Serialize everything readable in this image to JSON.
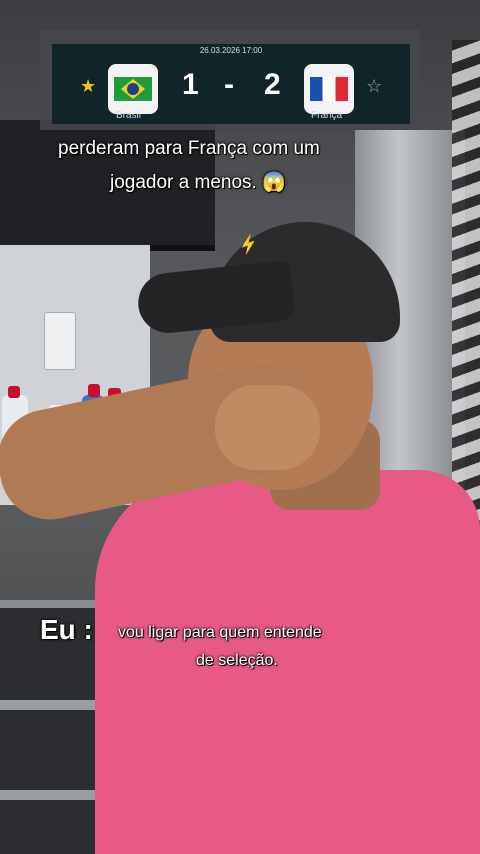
{
  "scoreboard": {
    "datetime": "26.03.2026 17:00",
    "home_team": "Brasil",
    "away_team": "França",
    "home_score": "1",
    "separator": "-",
    "away_score": "2",
    "home_star": "★",
    "away_star": "☆",
    "home_flag_icon": "brazil-flag-icon",
    "away_flag_icon": "france-flag-icon"
  },
  "top_caption": {
    "line1": "perderam para França com um",
    "line2": "jogador a menos. 😱"
  },
  "bottom_caption": {
    "speaker": "Eu :",
    "line1": "vou ligar para quem entende",
    "line2": "de seleção."
  },
  "colors": {
    "scoreboard_bg": "#102429",
    "shirt": "#e85a86",
    "brazil_green": "#1f9a3c",
    "brazil_yellow": "#f5d118",
    "france_blue": "#1a4fb0",
    "france_red": "#e1283a"
  }
}
